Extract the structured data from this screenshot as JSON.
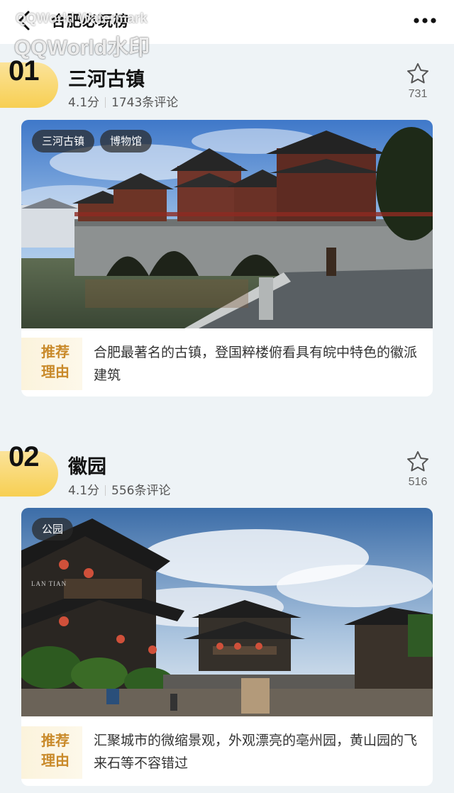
{
  "header": {
    "title": "合肥必玩榜",
    "watermark_small": "QQWorld Watermark",
    "watermark_large": "QQWorld水印"
  },
  "entries": [
    {
      "rank": "01",
      "name": "三河古镇",
      "rating": "4.1分",
      "reviews": "1743条评论",
      "favorites": "731",
      "tags": [
        "三河古镇",
        "博物馆"
      ],
      "reason_label_line1": "推荐",
      "reason_label_line2": "理由",
      "reason": "合肥最著名的古镇，登国粹楼俯看具有皖中特色的徽派建筑"
    },
    {
      "rank": "02",
      "name": "徽园",
      "rating": "4.1分",
      "reviews": "556条评论",
      "favorites": "516",
      "tags": [
        "公园"
      ],
      "reason_label_line1": "推荐",
      "reason_label_line2": "理由",
      "reason": "汇聚城市的微缩景观，外观漂亮的亳州园，黄山园的飞来石等不容错过",
      "photo_caption": "LAN TIAN"
    }
  ],
  "colors": {
    "accent_yellow": "#f7cf52",
    "reason_gold": "#c98a2a",
    "page_bg": "#eef3f6"
  },
  "icons": [
    "back-icon",
    "more-icon",
    "star-icon"
  ]
}
